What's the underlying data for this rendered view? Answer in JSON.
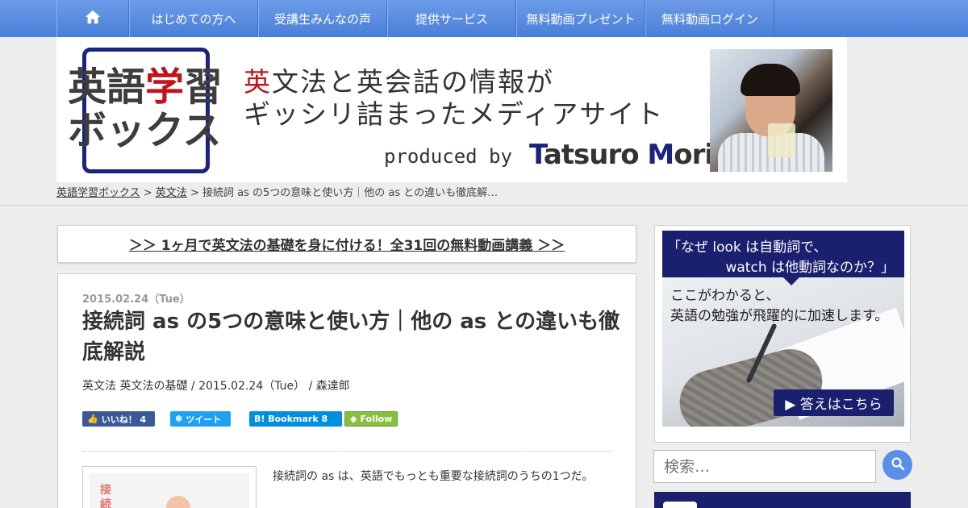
{
  "nav": {
    "items": [
      "はじめての方へ",
      "受講生みんなの声",
      "提供サービス",
      "無料動画プレゼント",
      "無料動画ログイン"
    ]
  },
  "header": {
    "logo": {
      "line1_a": "英語",
      "line1_b": "学",
      "line1_c": "習",
      "line2": "ボックス"
    },
    "tagline1_red": "英",
    "tagline1_rest": "文法と英会話の情報が",
    "tagline2": "ギッシリ詰まったメディアサイト",
    "produced_by": "produced by",
    "author_first_initial": "T",
    "author_first_rest": "atsuro ",
    "author_last_initial": "M",
    "author_last_rest": "ori"
  },
  "breadcrumb": {
    "home": "英語学習ボックス",
    "sep1": " > ",
    "category": "英文法",
    "sep2": " > ",
    "current": "接続詞 as の5つの意味と使い方｜他の as との違いも徹底解…"
  },
  "promo": {
    "link": "＞＞ 1ヶ月で英文法の基礎を身に付ける！全31回の無料動画講義 ＞＞"
  },
  "article": {
    "date": "2015.02.24（Tue）",
    "title": "接続詞 as の5つの意味と使い方｜他の as との違いも徹底解説",
    "meta_cat1": "英文法",
    "meta_cat2": "英文法の基礎",
    "meta_rest": " / 2015.02.24（Tue） / 森達郎",
    "like": "いいね！ 4",
    "tweet": "ツイート",
    "bookmark": "B! Bookmark  8",
    "follow": "Follow",
    "thumb_text": "接続",
    "excerpt": "接続詞の as は、英語でもっとも重要な接続詞のうちの1つだ。"
  },
  "sidebar": {
    "ad_head1": "「なぜ look は自動詞で、",
    "ad_head2": "watch は他動詞なのか？」",
    "ad_body1": "ここがわかると、",
    "ad_body2": "英語の勉強が飛躍的に加速します。",
    "ad_button": "▶ 答えはこちら",
    "search_placeholder": "検索…"
  }
}
